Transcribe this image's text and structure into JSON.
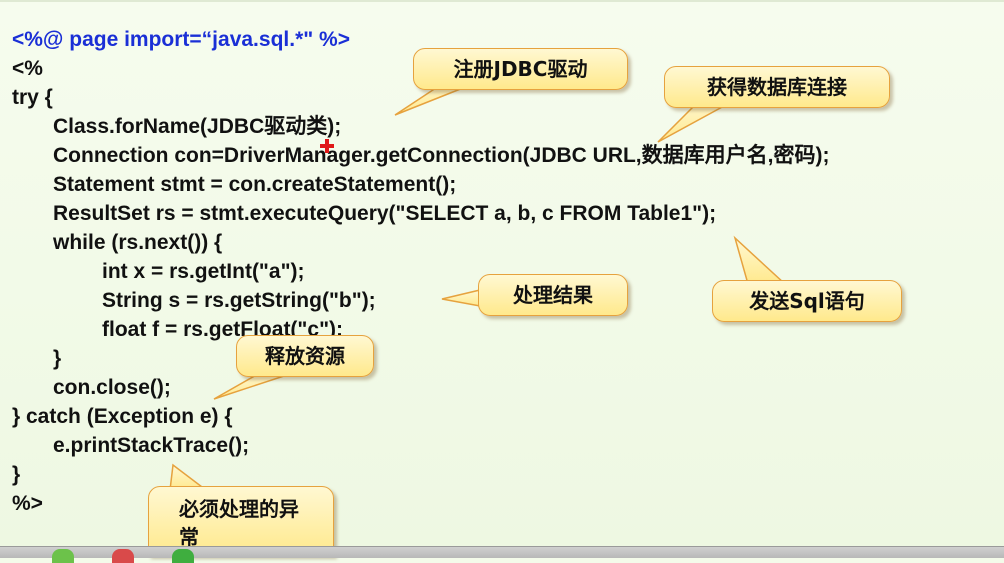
{
  "code": {
    "directive": "<%@ page import=“java.sql.*\" %>",
    "lines": [
      "<%",
      "try {",
      "Class.forName(JDBC驱动类);",
      "Connection con=DriverManager.getConnection(JDBC URL,数据库用户名,密码);",
      "Statement stmt = con.createStatement();",
      "ResultSet rs = stmt.executeQuery(\"SELECT a, b, c FROM Table1\");",
      "while (rs.next()) {",
      "int x = rs.getInt(\"a\");",
      "String s = rs.getString(\"b\");",
      "float f = rs.getFloat(\"c\");",
      "}",
      "con.close();",
      "} catch (Exception e) {",
      "e.printStackTrace();",
      "}",
      "%>"
    ]
  },
  "callouts": {
    "register_driver": "注册JDBC驱动",
    "get_connection": "获得数据库连接",
    "process_result": "处理结果",
    "send_sql": "发送Sql语句",
    "release_resources": "释放资源",
    "handle_exception": "必须处理的异常"
  },
  "colors": {
    "directive": "#1a2fd6",
    "code_text": "#111111",
    "callout_fill": "#ffe98c",
    "callout_border": "#e6a23e",
    "background": "#f4fbea"
  },
  "icons": [
    "cursor-plus-icon",
    "taskbar-app-icon"
  ]
}
